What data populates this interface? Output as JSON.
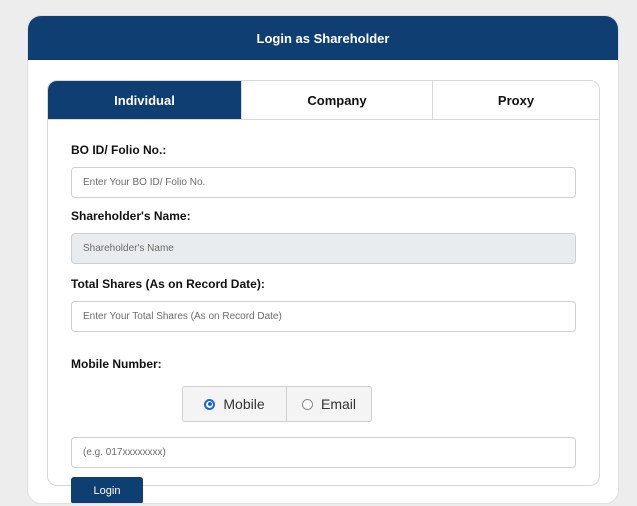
{
  "header": {
    "title": "Login as Shareholder"
  },
  "tabs": [
    {
      "label": "Individual",
      "active": true
    },
    {
      "label": "Company",
      "active": false
    },
    {
      "label": "Proxy",
      "active": false
    }
  ],
  "form": {
    "bo_label": "BO ID/ Folio No.:",
    "bo_placeholder": "Enter Your BO ID/ Folio No.",
    "name_label": "Shareholder's Name:",
    "name_placeholder": "Shareholder's Name",
    "shares_label": "Total Shares (As on Record Date):",
    "shares_placeholder": "Enter Your Total Shares (As on Record Date)",
    "contact_label": "Mobile Number:",
    "contact_options": [
      {
        "label": "Mobile",
        "checked": true
      },
      {
        "label": "Email",
        "checked": false
      }
    ],
    "contact_placeholder": "(e.g. 017xxxxxxxx)",
    "login_label": "Login"
  },
  "colors": {
    "brand": "#0f3e73",
    "radio_accent": "#1a67d2"
  }
}
